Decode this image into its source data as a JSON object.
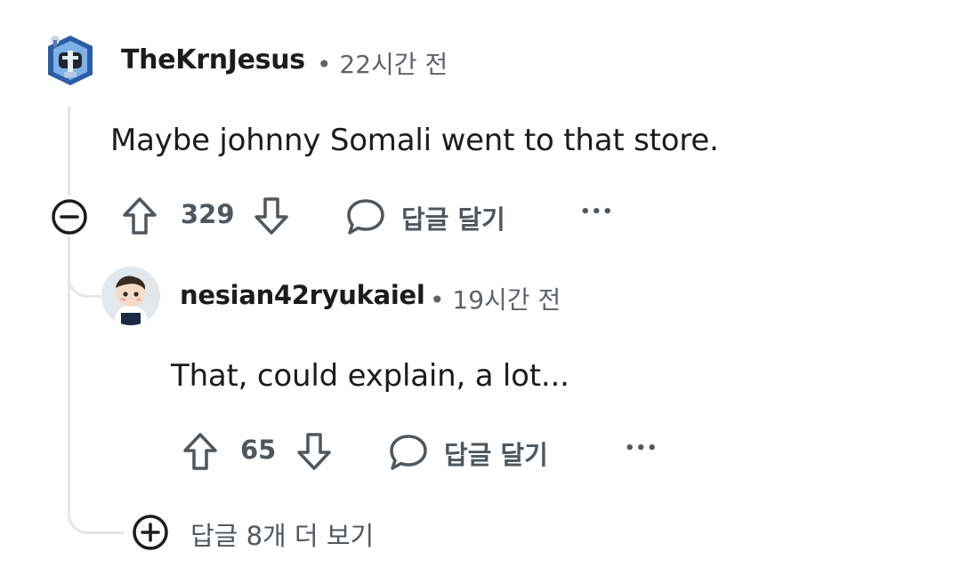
{
  "comments": [
    {
      "username": "TheKrnJesus",
      "time": "• 22시간 전",
      "body": "Maybe johnny Somali went to that store.",
      "score": "329",
      "reply_label": "답글 달기",
      "more": "•••"
    },
    {
      "username": "nesian42ryukaiel",
      "time": "• 19시간 전",
      "body": "That, could explain, a lot...",
      "score": "65",
      "reply_label": "답글 달기",
      "more": "•••"
    }
  ],
  "more_replies_label": "답글 8개 더 보기",
  "icons": {
    "collapse": "minus-circle-icon",
    "upvote": "arrow-up-icon",
    "downvote": "arrow-down-icon",
    "reply": "speech-bubble-icon",
    "more": "ellipsis-icon",
    "expand": "plus-circle-icon"
  }
}
